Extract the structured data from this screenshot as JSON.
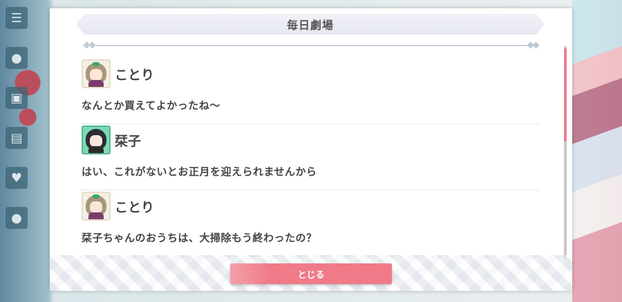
{
  "dialog": {
    "title": "毎日劇場",
    "close_label": "とじる"
  },
  "messages": [
    {
      "speaker": "ことり",
      "avatar": "kotori-avatar",
      "text": "なんとか買えてよかったね〜"
    },
    {
      "speaker": "栞子",
      "avatar": "shioriko-avatar",
      "text": "はい、これがないとお正月を迎えられませんから"
    },
    {
      "speaker": "ことり",
      "avatar": "kotori-avatar",
      "text": "栞子ちゃんのおうちは、大掃除もう終わったの？"
    }
  ],
  "colors": {
    "accent": "#f07a88",
    "text": "#444444",
    "title_bar": "#e9eaf3"
  }
}
